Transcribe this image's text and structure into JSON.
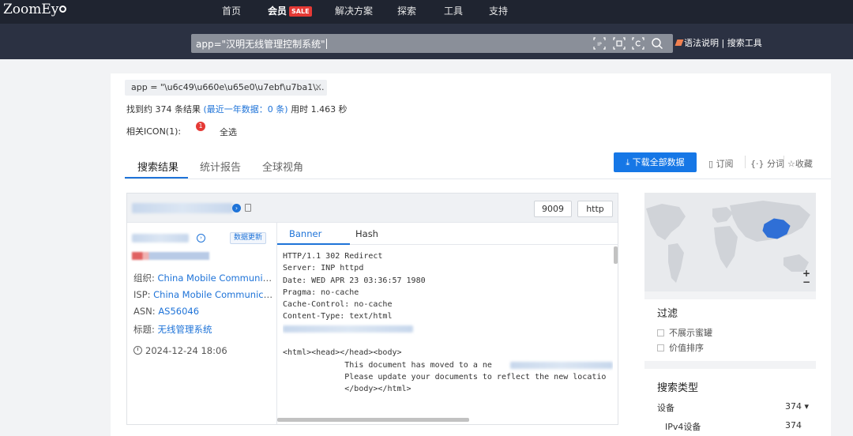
{
  "logo": {
    "text": "ZoomEy"
  },
  "nav": [
    {
      "label": "首页"
    },
    {
      "label": "会员",
      "badge": "SALE"
    },
    {
      "label": "解决方案"
    },
    {
      "label": "探索"
    },
    {
      "label": "工具"
    },
    {
      "label": "支持"
    }
  ],
  "search": {
    "value": "app=\"汉明无线管理控制系统\"",
    "icons": [
      "ip-search-icon",
      "domain-search-icon",
      "cert-search-icon",
      "search-icon"
    ],
    "syntax_label": "语法说明",
    "tools_label": "搜索工具"
  },
  "filter_chip": {
    "text": "app = \"\\u6c49\\u660e\\u65e0\\u7ebf\\u7ba1\\..."
  },
  "results": {
    "prefix": "找到约 374 条结果",
    "recent_link": "(最近一年数据：0 条)",
    "time": "用时 1.463 秒"
  },
  "related_icon": {
    "label": "相关ICON(1):",
    "badge": "1",
    "select_all": "全选"
  },
  "tabs": [
    {
      "label": "搜索结果",
      "active": true
    },
    {
      "label": "统计报告",
      "active": false
    },
    {
      "label": "全球视角",
      "active": false
    }
  ],
  "actions": {
    "download": "下载全部数据",
    "subscribe": "订阅",
    "tokenize": "分词",
    "favorite": "收藏"
  },
  "result": {
    "port": "9009",
    "protocol": "http",
    "update_label": "数据更新",
    "org_label": "组织: ",
    "org_value": "China Mobile Communic...",
    "isp_label": "ISP: ",
    "isp_value": "China Mobile Communicat...",
    "asn_label": "ASN: ",
    "asn_value": "AS56046",
    "title_label": "标题: ",
    "title_value": "无线管理系统",
    "timestamp": "2024-12-24 18:06",
    "banner_tabs": [
      {
        "label": "Banner",
        "active": true
      },
      {
        "label": "Hash",
        "active": false
      }
    ],
    "banner_lines": [
      "HTTP/1.1 302 Redirect",
      "Server: INP httpd",
      "Date: WED APR 23 03:36:57 1980",
      "Pragma: no-cache",
      "Cache-Control: no-cache",
      "Content-Type: text/html",
      "",
      "",
      "<html><head></head><body>",
      "             This document has moved to a ne",
      "             Please update your documents to reflect the new locatio",
      "             </body></html>"
    ]
  },
  "sidebar": {
    "filter_title": "过滤",
    "filters": [
      {
        "label": "不展示蜜罐"
      },
      {
        "label": "价值排序"
      }
    ],
    "type_title": "搜索类型",
    "types": [
      {
        "label": "设备",
        "count": "374 ▾"
      },
      {
        "label": "IPv4设备",
        "count": "374"
      }
    ],
    "zoom_in": "+",
    "zoom_out": "−"
  },
  "colors": {
    "accent": "#1e73d8",
    "nav_bg": "#1f2430",
    "search_band_bg": "#2b3142",
    "sale_badge": "#e53935",
    "map_highlight": "#2f6fd6"
  }
}
